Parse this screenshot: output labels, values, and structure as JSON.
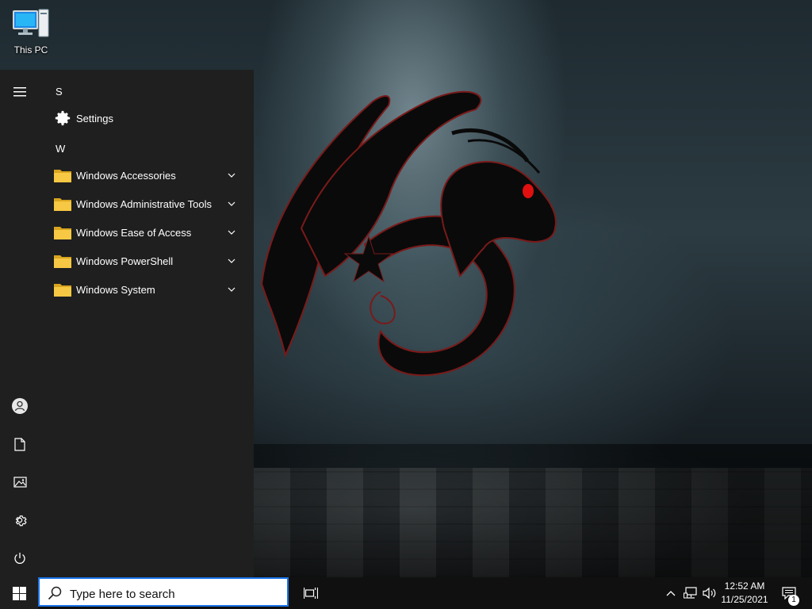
{
  "desktop": {
    "icons": [
      {
        "label": "This PC",
        "icon": "computer-icon"
      }
    ]
  },
  "start_menu": {
    "rail": [
      {
        "name": "hamburger-menu",
        "icon": "hamburger-icon"
      },
      {
        "name": "account",
        "icon": "user-icon"
      },
      {
        "name": "documents",
        "icon": "document-icon"
      },
      {
        "name": "pictures",
        "icon": "picture-icon"
      },
      {
        "name": "settings",
        "icon": "gear-icon"
      },
      {
        "name": "power",
        "icon": "power-icon"
      }
    ],
    "sections": [
      {
        "letter": "S",
        "items": [
          {
            "label": "Settings",
            "icon": "gear-icon",
            "expandable": false
          }
        ]
      },
      {
        "letter": "W",
        "items": [
          {
            "label": "Windows Accessories",
            "icon": "folder-icon",
            "expandable": true
          },
          {
            "label": "Windows Administrative Tools",
            "icon": "folder-icon",
            "expandable": true
          },
          {
            "label": "Windows Ease of Access",
            "icon": "folder-icon",
            "expandable": true
          },
          {
            "label": "Windows PowerShell",
            "icon": "folder-icon",
            "expandable": true
          },
          {
            "label": "Windows System",
            "icon": "folder-icon",
            "expandable": true
          }
        ]
      }
    ]
  },
  "taskbar": {
    "search": {
      "placeholder": "Type here to search",
      "value": ""
    },
    "tray": {
      "icons": [
        "chevron-up-icon",
        "network-icon",
        "volume-icon"
      ]
    },
    "clock": {
      "time": "12:52 AM",
      "date": "11/25/2021"
    },
    "notifications": {
      "count": "1"
    }
  },
  "colors": {
    "start_bg": "#1f1f1f",
    "taskbar_bg": "#101010",
    "search_border": "#1a73e8",
    "folder": "#f4c430",
    "dragon_eye": "#e01010"
  }
}
